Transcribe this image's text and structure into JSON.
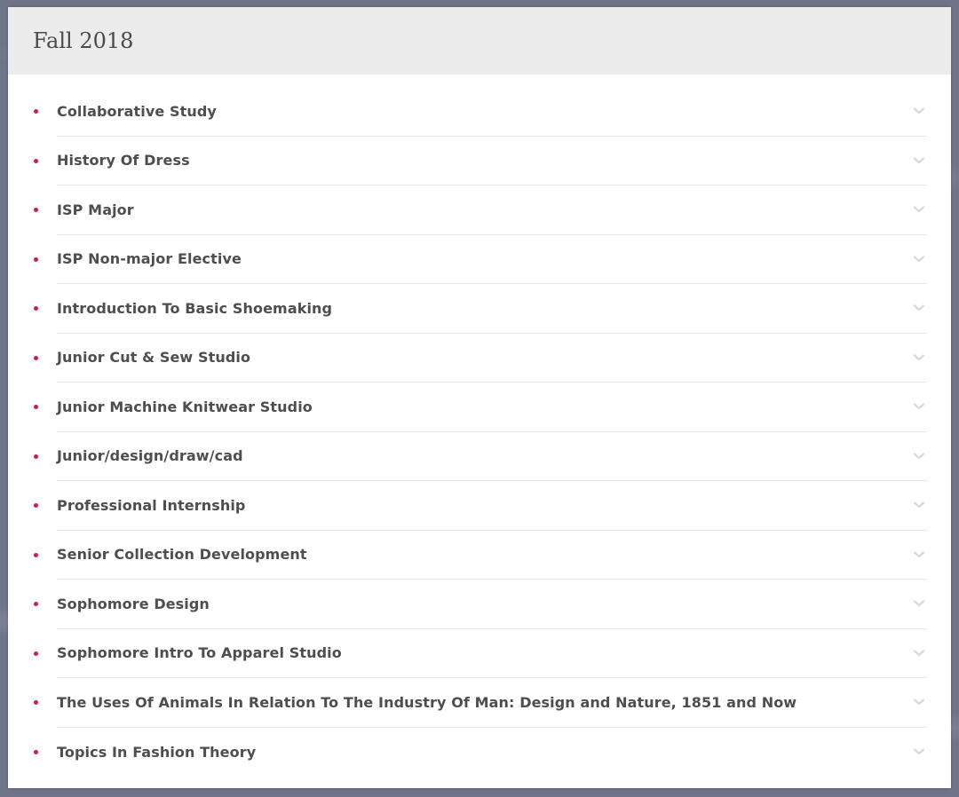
{
  "section": {
    "title": "Fall 2018"
  },
  "colors": {
    "bullet": "#c0234e",
    "chevron": "#d8d8d8",
    "header_bg": "#ececec"
  },
  "courses": [
    {
      "label": "Collaborative Study",
      "icon": "chevron-down-icon"
    },
    {
      "label": "History Of Dress",
      "icon": "chevron-down-icon"
    },
    {
      "label": "ISP Major",
      "icon": "chevron-down-icon"
    },
    {
      "label": "ISP Non-major Elective",
      "icon": "chevron-down-icon"
    },
    {
      "label": "Introduction To Basic Shoemaking",
      "icon": "chevron-down-icon"
    },
    {
      "label": "Junior Cut & Sew Studio",
      "icon": "chevron-down-icon"
    },
    {
      "label": "Junior Machine Knitwear Studio",
      "icon": "chevron-down-icon"
    },
    {
      "label": "Junior/design/draw/cad",
      "icon": "chevron-down-icon"
    },
    {
      "label": "Professional Internship",
      "icon": "chevron-down-icon"
    },
    {
      "label": "Senior Collection Development",
      "icon": "chevron-down-icon"
    },
    {
      "label": "Sophomore Design",
      "icon": "chevron-down-icon"
    },
    {
      "label": "Sophomore Intro To Apparel Studio",
      "icon": "chevron-down-icon"
    },
    {
      "label": "The Uses Of Animals In Relation To The Industry Of Man: Design and Nature, 1851 and Now",
      "icon": "chevron-down-icon"
    },
    {
      "label": "Topics In Fashion Theory",
      "icon": "chevron-down-icon"
    }
  ]
}
